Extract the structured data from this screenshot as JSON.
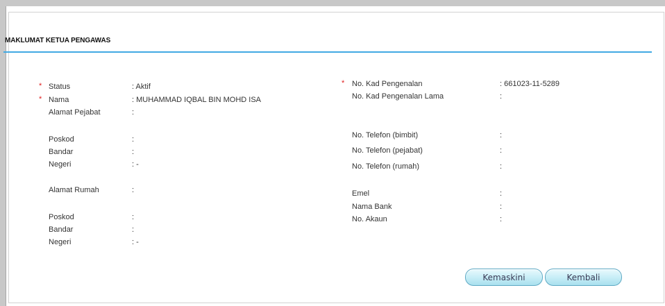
{
  "section": {
    "title": "MAKLUMAT KETUA PENGAWAS"
  },
  "left": {
    "status": {
      "label": "Status",
      "value": ": Aktif",
      "required": "*"
    },
    "nama": {
      "label": "Nama",
      "value": ": MUHAMMAD IQBAL BIN MOHD ISA",
      "required": "*"
    },
    "alamat_pejabat": {
      "label": "Alamat Pejabat",
      "value": ":"
    },
    "poskod1": {
      "label": "Poskod",
      "value": ":"
    },
    "bandar1": {
      "label": "Bandar",
      "value": ":"
    },
    "negeri1": {
      "label": "Negeri",
      "value": ": -"
    },
    "alamat_rumah": {
      "label": "Alamat Rumah",
      "value": ":"
    },
    "poskod2": {
      "label": "Poskod",
      "value": ":"
    },
    "bandar2": {
      "label": "Bandar",
      "value": ":"
    },
    "negeri2": {
      "label": "Negeri",
      "value": ": -"
    }
  },
  "right": {
    "no_kp": {
      "label": "No. Kad Pengenalan",
      "value": ": 661023-11-5289",
      "required": "*"
    },
    "no_kp_lama": {
      "label": "No. Kad Pengenalan Lama",
      "value": ":"
    },
    "tel_bimbit": {
      "label": "No. Telefon (bimbit)",
      "value": ":"
    },
    "tel_pejabat": {
      "label": "No. Telefon (pejabat)",
      "value": ":"
    },
    "tel_rumah": {
      "label": "No. Telefon (rumah)",
      "value": ":"
    },
    "emel": {
      "label": "Emel",
      "value": ":"
    },
    "nama_bank": {
      "label": "Nama Bank",
      "value": ":"
    },
    "no_akaun": {
      "label": "No. Akaun",
      "value": ":"
    }
  },
  "buttons": {
    "kemaskini": "Kemaskini",
    "kembali": "Kembali"
  }
}
